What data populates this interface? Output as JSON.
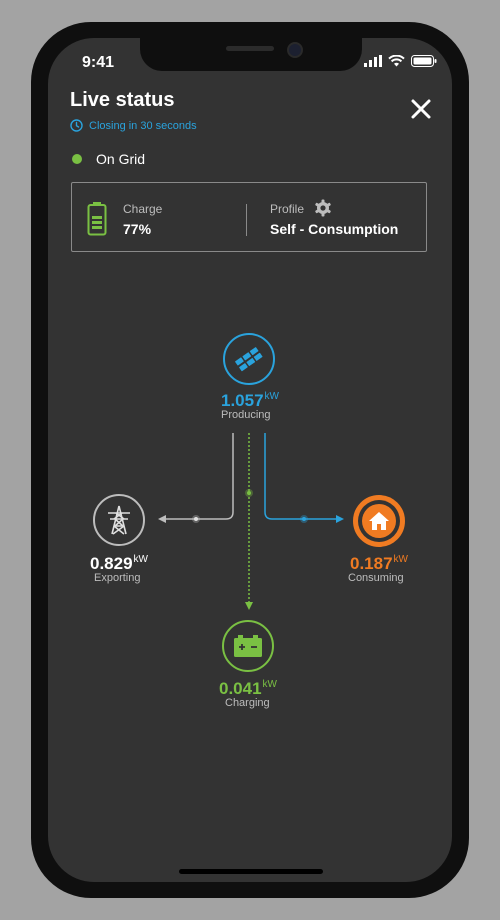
{
  "status_bar": {
    "time": "9:41",
    "icons": [
      "signal-icon",
      "wifi-icon",
      "battery-icon"
    ]
  },
  "header": {
    "title": "Live status",
    "closing_text": "Closing in 30 seconds",
    "close_icon": "close-icon"
  },
  "grid_status": {
    "label": "On Grid",
    "color": "#7ac043"
  },
  "card": {
    "charge": {
      "label": "Charge",
      "value": "77%",
      "icon": "battery-icon"
    },
    "profile": {
      "label": "Profile",
      "value": "Self - Consumption",
      "icon": "gear-icon"
    }
  },
  "flow": {
    "producing": {
      "value": "1.057",
      "unit": "kW",
      "label": "Producing",
      "color": "#2aa3dd",
      "icon": "solar-panel-icon"
    },
    "exporting": {
      "value": "0.829",
      "unit": "kW",
      "label": "Exporting",
      "color": "#ffffff",
      "icon": "power-tower-icon"
    },
    "consuming": {
      "value": "0.187",
      "unit": "kW",
      "label": "Consuming",
      "color": "#f07b22",
      "icon": "house-icon"
    },
    "charging": {
      "value": "0.041",
      "unit": "kW",
      "label": "Charging",
      "color": "#7ac043",
      "icon": "car-battery-icon"
    }
  }
}
